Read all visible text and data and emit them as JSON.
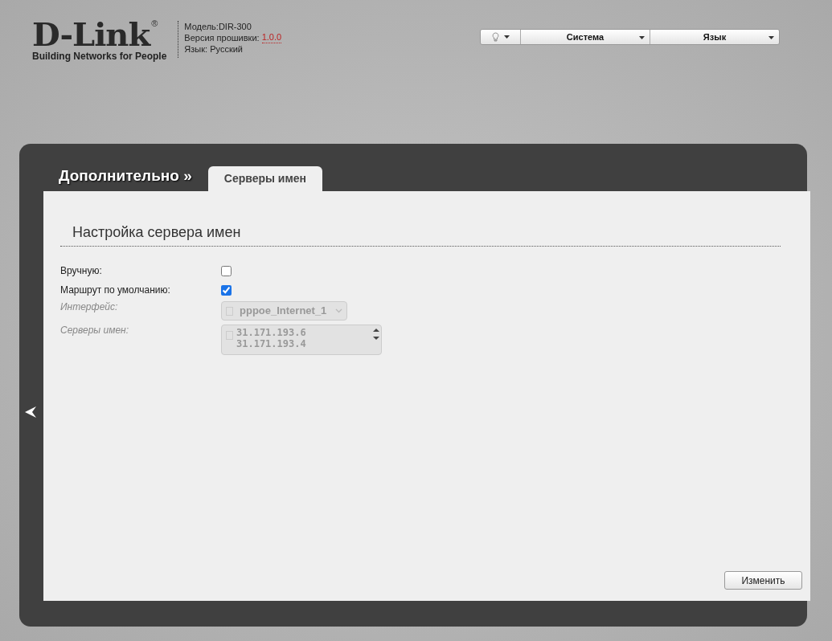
{
  "header": {
    "logo": {
      "brand": "D-Link",
      "registered": "®",
      "tagline": "Building Networks for People"
    },
    "info": [
      {
        "text": "Модель:DIR-300"
      },
      {
        "text": "Версия прошивки: ",
        "link": "1.0.0"
      },
      {
        "text": "Язык: Русский"
      }
    ]
  },
  "top_menu": [
    {
      "kind": "icon"
    },
    {
      "kind": "text",
      "label": "Система"
    },
    {
      "kind": "text",
      "label": "Язык"
    }
  ],
  "breadcrumb": "Дополнительно »",
  "tabs": [
    {
      "label": "Серверы имен",
      "selected": true
    }
  ],
  "section_title": "Настройка сервера имен",
  "fields": [
    {
      "kind": "checkbox",
      "label": "Вручную:",
      "checked": false,
      "disabled": false
    },
    {
      "kind": "checkbox",
      "label": "Маршрут по умолчанию:",
      "checked": true,
      "disabled": false
    },
    {
      "kind": "select",
      "label": "Интерфейс:",
      "value": "pppoe_Internet_1",
      "disabled": true
    },
    {
      "kind": "textarea",
      "label": "Серверы имен:",
      "value": "31.171.193.6\n31.171.193.4",
      "disabled": true
    }
  ],
  "button": "Изменить"
}
